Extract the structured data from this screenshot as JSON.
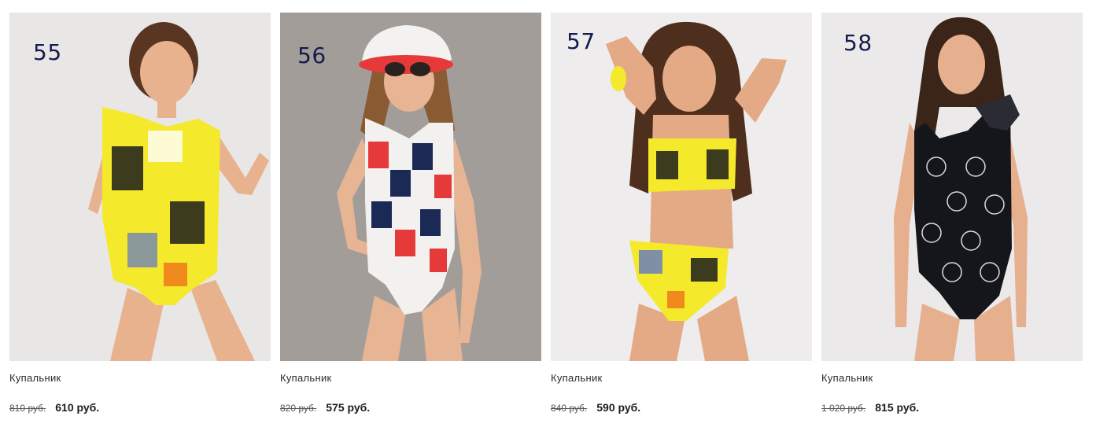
{
  "products": [
    {
      "number": "55",
      "title": "Купальник",
      "old_price": "810 руб.",
      "price": "610 руб.",
      "background": "#e9e6e6",
      "suit_color": "#f4ea2b",
      "suit_print": "looney-tunes-print",
      "skin": "#e8b28f",
      "hair": "#5a3522"
    },
    {
      "number": "56",
      "title": "Купальник",
      "old_price": "820 руб.",
      "price": "575 руб.",
      "background": "#a39d99",
      "suit_color": "#f3f1ef",
      "suit_print": "tom-and-jerry-print",
      "skin": "#e7b594",
      "hair": "#8a5a33"
    },
    {
      "number": "57",
      "title": "Купальник",
      "old_price": "840 руб.",
      "price": "590 руб.",
      "background": "#eeecec",
      "suit_color": "#f4ea2b",
      "suit_print": "looney-tunes-print",
      "skin": "#e4a985",
      "hair": "#4e2e1c"
    },
    {
      "number": "58",
      "title": "Купальник",
      "old_price": "1 020 руб.",
      "price": "815 руб.",
      "background": "#ebe9e9",
      "suit_color": "#15161c",
      "suit_print": "hello-kitty-print",
      "skin": "#e6b08f",
      "hair": "#3b2418"
    }
  ]
}
